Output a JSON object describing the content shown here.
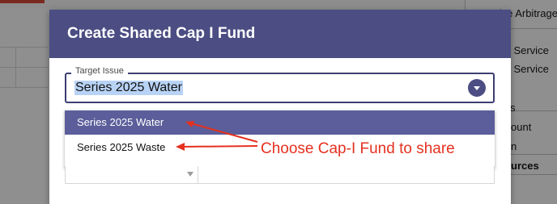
{
  "background": {
    "right_panel_items": [
      "Negative Arbitrage",
      "ot Service",
      "ot Service",
      "s",
      "ount",
      "n",
      "urces"
    ]
  },
  "modal": {
    "title": "Create Shared Cap I Fund",
    "target_issue": {
      "label": "Target Issue",
      "value": "Series 2025 Water"
    },
    "options": [
      {
        "label": "Series 2025 Water",
        "selected": true
      },
      {
        "label": "Series 2025 Waste",
        "selected": false
      }
    ]
  },
  "annotation": {
    "text": "Choose Cap-I Fund to share",
    "color": "#e5311f"
  },
  "colors": {
    "header": "#4b4d83",
    "selected_option": "#5b5e9a",
    "annotation": "#e5311f"
  }
}
